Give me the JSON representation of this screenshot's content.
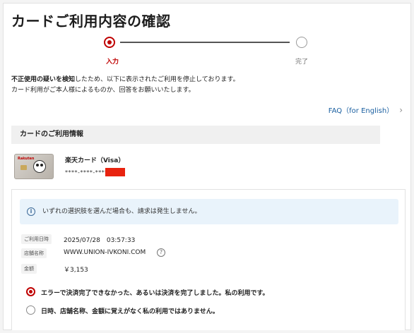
{
  "page": {
    "title": "カードご利用内容の確認"
  },
  "stepper": {
    "steps": [
      {
        "label": "入力",
        "state": "active"
      },
      {
        "label": "完了",
        "state": "inactive"
      }
    ],
    "active_color": "#bf0000"
  },
  "notice": {
    "line1_bold": "不正使用の疑いを検知",
    "line1_rest": "したため、以下に表示されたご利用を停止しております。",
    "line2": "カード利用がご本人様によるものか、回答をお願いいたします。"
  },
  "faq": {
    "label": "FAQ（for English）",
    "chevron": "›"
  },
  "card_section": {
    "heading": "カードのご利用情報",
    "card_name": "楽天カード（Visa）",
    "card_number_masked": "****-****-****-",
    "card_logo_text": "Rakuten"
  },
  "info_banner": {
    "icon": "info-icon",
    "text": "いずれの選択肢を選んだ場合も、請求は発生しません。"
  },
  "transaction": {
    "rows": [
      {
        "label": "ご利用日時",
        "value": "2025/07/28　03:57:33"
      },
      {
        "label": "店舗名称",
        "value": "WWW.UNION-IVKONI.COM"
      },
      {
        "label": "金額",
        "value": "￥3,153"
      }
    ],
    "help_icon": "question-icon"
  },
  "options": [
    {
      "label": "エラーで決済完了できなかった、あるいは決済を完了しました。私の利用です。",
      "selected": true
    },
    {
      "label": "日時、店舗名称、金額に覚えがなく私の利用ではありません。",
      "selected": false
    }
  ]
}
